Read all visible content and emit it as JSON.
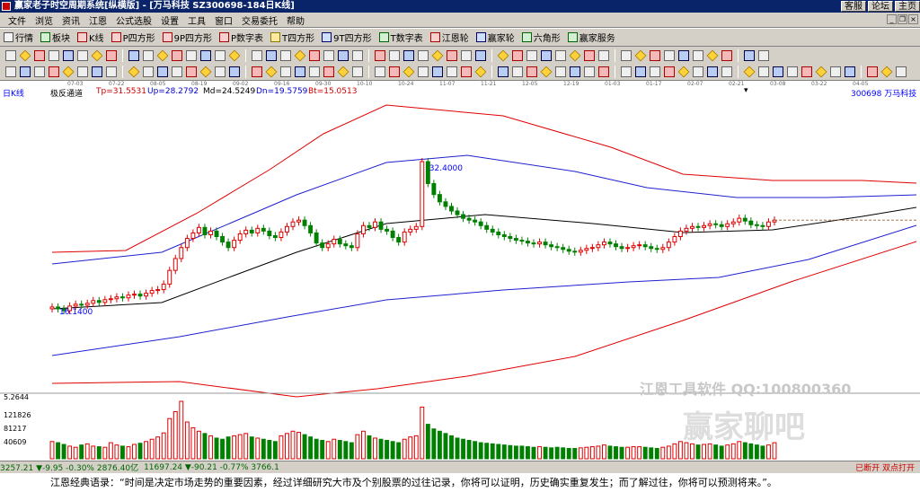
{
  "window": {
    "title": "赢家老子时空周期系统[纵横版] - [万马科技   SZ300698-184日K线]",
    "buttons": [
      "客服",
      "论坛",
      "主页"
    ]
  },
  "menu": [
    "文件",
    "浏览",
    "资讯",
    "江恩",
    "公式选股",
    "设置",
    "工具",
    "窗口",
    "交易委托",
    "帮助"
  ],
  "toolbar1": [
    {
      "label": "行情",
      "icon": "grid-icon",
      "c": ""
    },
    {
      "label": "板块",
      "icon": "bar-chart-icon",
      "c": "g"
    },
    {
      "label": "K线",
      "icon": "candle-icon",
      "c": "r"
    },
    {
      "label": "P四方形",
      "icon": "square-p-icon",
      "c": "r"
    },
    {
      "label": "9P四方形",
      "icon": "square-9p-icon",
      "c": "r"
    },
    {
      "label": "P数字表",
      "icon": "table-p-icon",
      "c": "r"
    },
    {
      "label": "T四方形",
      "icon": "square-t-icon",
      "c": "y"
    },
    {
      "label": "9T四方形",
      "icon": "square-9t-icon",
      "c": "b"
    },
    {
      "label": "T数字表",
      "icon": "table-t-icon",
      "c": "g"
    },
    {
      "label": "江恩轮",
      "icon": "gann-wheel-icon",
      "c": "r"
    },
    {
      "label": "赢家轮",
      "icon": "winner-wheel-icon",
      "c": "b"
    },
    {
      "label": "六角形",
      "icon": "hexagon-icon",
      "c": "g"
    },
    {
      "label": "赢家服务",
      "icon": "service-icon",
      "c": "g"
    }
  ],
  "toolbar2_count": 56,
  "toolbar3_count": 66,
  "dates": [
    "07-03",
    "07-22",
    "08-05",
    "08-19",
    "09-02",
    "09-16",
    "09-30",
    "10-10",
    "10-24",
    "11-07",
    "11-21",
    "12-05",
    "12-19",
    "01-03",
    "01-17",
    "02-07",
    "02-21",
    "03-08",
    "03-22",
    "04-05"
  ],
  "info": {
    "period": "日K线",
    "indicator": "极反通道",
    "tp": "Tp=31.5531",
    "up": "Up=28.2792",
    "md": "Md=24.5249",
    "dn": "Dn=19.5759",
    "bt": "Bt=15.0513",
    "stock": "300698  万马科技"
  },
  "chart_data": {
    "type": "candlestick",
    "price_labels": {
      "high": "32.4000",
      "low": "16.1400"
    },
    "volume_axis": [
      "5.2644",
      "121826",
      "81217",
      "40609"
    ],
    "colors": {
      "up": "#e00000",
      "down": "#008000",
      "tp": "#e00000",
      "up_line": "#2020d0",
      "md": "#000000",
      "dn": "#2020d0",
      "bt": "#e00000"
    },
    "prices": [
      16.5,
      16.3,
      16.1,
      16.6,
      16.8,
      16.7,
      16.9,
      17.2,
      17.0,
      17.3,
      17.4,
      17.6,
      17.5,
      17.8,
      17.9,
      17.7,
      18.0,
      18.3,
      18.4,
      19.0,
      20.5,
      21.8,
      23.0,
      24.0,
      24.6,
      25.2,
      24.4,
      24.8,
      24.2,
      23.6,
      23.0,
      23.8,
      24.5,
      24.9,
      24.6,
      25.1,
      24.8,
      24.3,
      24.1,
      24.7,
      25.3,
      25.8,
      26.0,
      25.4,
      24.6,
      23.5,
      23.0,
      23.4,
      23.9,
      23.4,
      23.2,
      23.0,
      24.5,
      25.4,
      25.2,
      25.8,
      25.0,
      24.8,
      24.1,
      23.6,
      24.7,
      25.0,
      25.3,
      32.4,
      30.0,
      28.8,
      28.0,
      27.5,
      27.0,
      26.6,
      26.2,
      26.0,
      25.8,
      25.4,
      25.0,
      24.7,
      24.4,
      24.2,
      24.0,
      23.8,
      23.7,
      23.5,
      23.4,
      23.6,
      23.3,
      23.1,
      23.0,
      22.8,
      22.6,
      22.5,
      22.7,
      22.9,
      23.0,
      23.3,
      23.6,
      23.4,
      23.1,
      22.9,
      23.0,
      23.2,
      23.3,
      23.1,
      22.9,
      22.8,
      23.0,
      23.6,
      24.2,
      24.8,
      25.1,
      25.3,
      25.2,
      25.4,
      25.6,
      25.5,
      25.3,
      25.6,
      25.8,
      26.2,
      25.9,
      25.5,
      25.4,
      25.3,
      25.8,
      26.0
    ],
    "volumes": [
      30,
      28,
      25,
      22,
      20,
      24,
      26,
      22,
      21,
      20,
      28,
      24,
      22,
      21,
      25,
      27,
      30,
      34,
      38,
      45,
      70,
      82,
      100,
      64,
      54,
      48,
      44,
      40,
      36,
      34,
      38,
      40,
      42,
      44,
      38,
      36,
      34,
      32,
      30,
      40,
      44,
      48,
      46,
      42,
      38,
      34,
      32,
      30,
      34,
      32,
      30,
      28,
      42,
      48,
      40,
      36,
      34,
      32,
      30,
      28,
      34,
      38,
      40,
      90,
      60,
      52,
      48,
      44,
      40,
      36,
      34,
      32,
      30,
      28,
      27,
      26,
      25,
      24,
      23,
      22,
      22,
      21,
      20,
      21,
      20,
      19,
      20,
      19,
      18,
      18,
      19,
      20,
      21,
      22,
      24,
      22,
      21,
      20,
      20,
      21,
      21,
      20,
      19,
      18,
      20,
      22,
      26,
      30,
      28,
      26,
      24,
      25,
      26,
      24,
      22,
      24,
      26,
      30,
      28,
      26,
      24,
      22,
      24,
      28
    ]
  },
  "status": {
    "index1": "3257.21 ▼-9.95 -0.30% 2876.40亿",
    "index2": "11697.24 ▼-90.21 -0.77% 3766.1",
    "right": "已断开 双点打开"
  },
  "footer": "江恩经典语录：“时间是决定市场走势的重要因素，经过详细研究大市及个别股票的过往记录，你将可以证明，历史确实重复发生；而了解过往，你将可以预测将来。”。",
  "watermark": {
    "line1": "江恩工具软件  QQ:100800360",
    "line2": "赢家聊吧"
  }
}
